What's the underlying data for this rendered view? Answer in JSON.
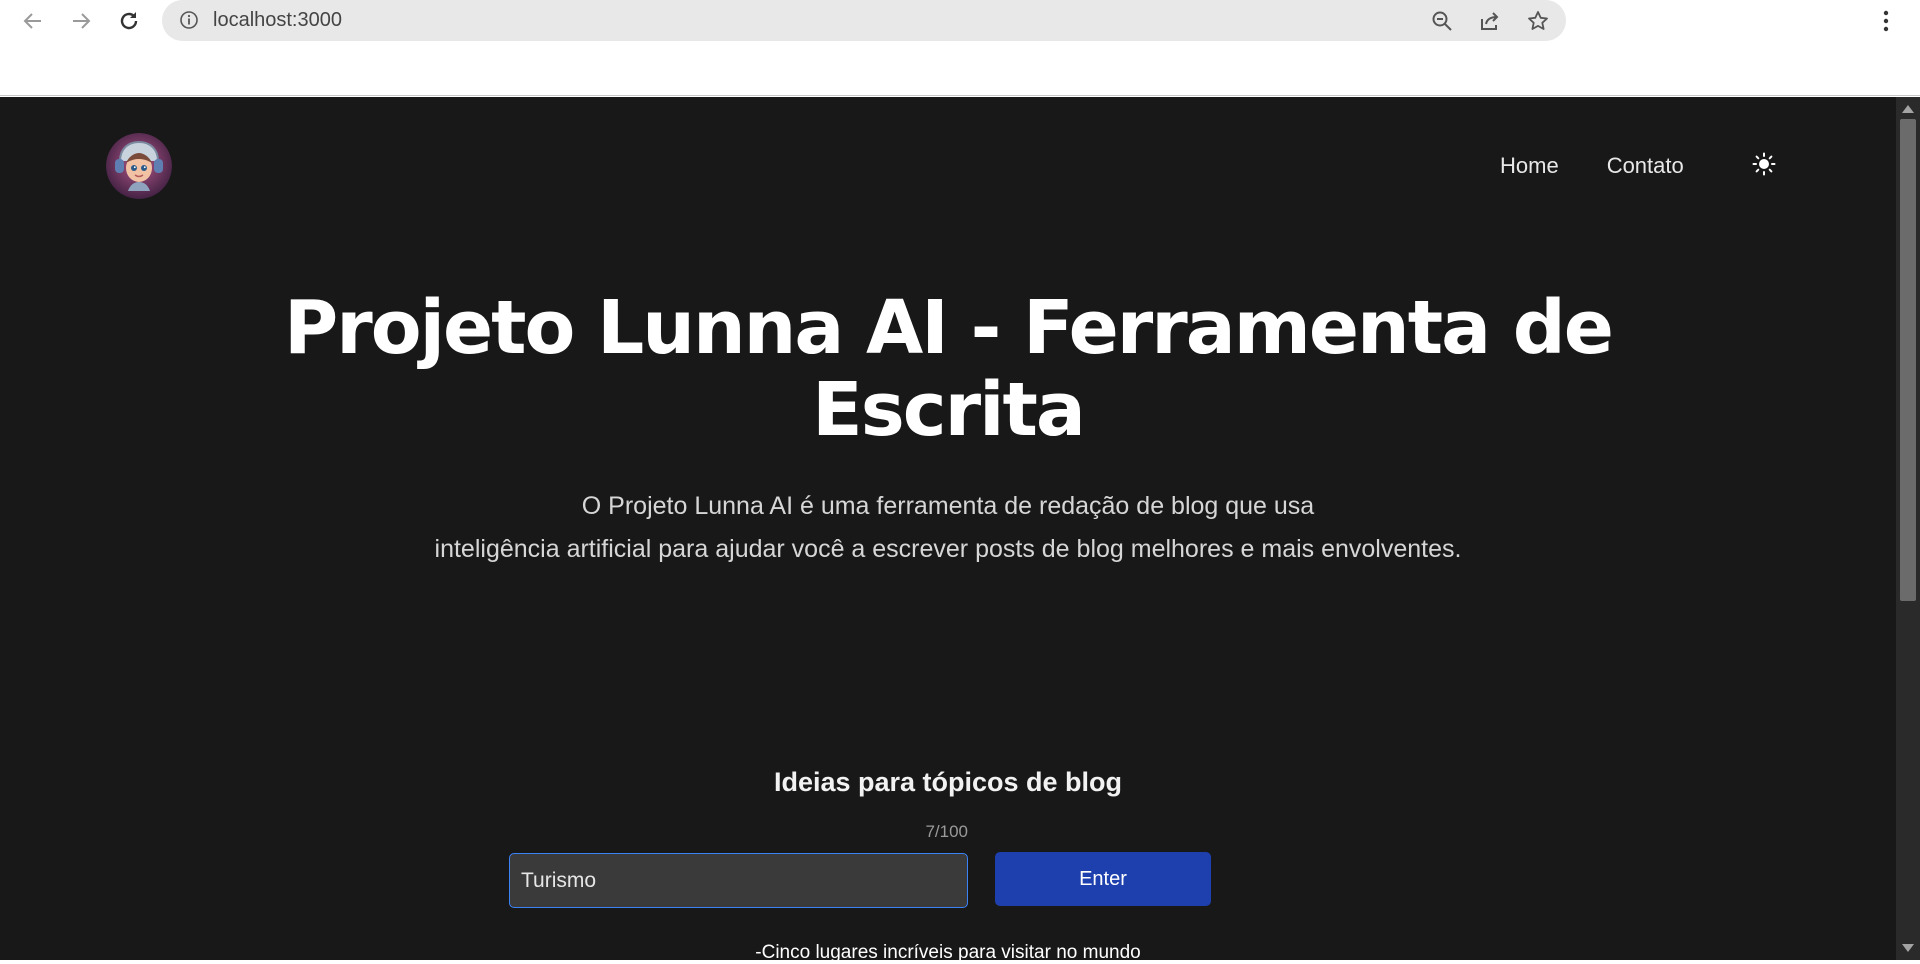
{
  "browser": {
    "url": "localhost:3000",
    "icons": {
      "back": "arrow-left-icon",
      "forward": "arrow-right-icon",
      "reload": "reload-icon",
      "info": "info-icon",
      "zoom": "zoom-out-icon",
      "share": "share-icon",
      "bookmark": "star-icon",
      "menu": "kebab-menu-icon"
    }
  },
  "header": {
    "logo_icon": "avatar-robot-girl",
    "nav": [
      {
        "label": "Home"
      },
      {
        "label": "Contato"
      }
    ],
    "theme_toggle_icon": "sun-icon"
  },
  "hero": {
    "title": "Projeto Lunna AI - Ferramenta de Escrita",
    "description_line1": "O Projeto Lunna AI é uma ferramenta de redação de blog que usa",
    "description_line2": "inteligência artificial para ajudar você a escrever posts de blog melhores e mais envolventes."
  },
  "topic_form": {
    "title": "Ideias para tópicos de blog",
    "char_count": "7/100",
    "input_value": "Turismo",
    "button_label": "Enter"
  },
  "results": [
    "-Cinco lugares incríveis para visitar no mundo"
  ],
  "colors": {
    "page_background": "#181818",
    "button": "#1e40af",
    "input_border": "#3b82f6"
  }
}
